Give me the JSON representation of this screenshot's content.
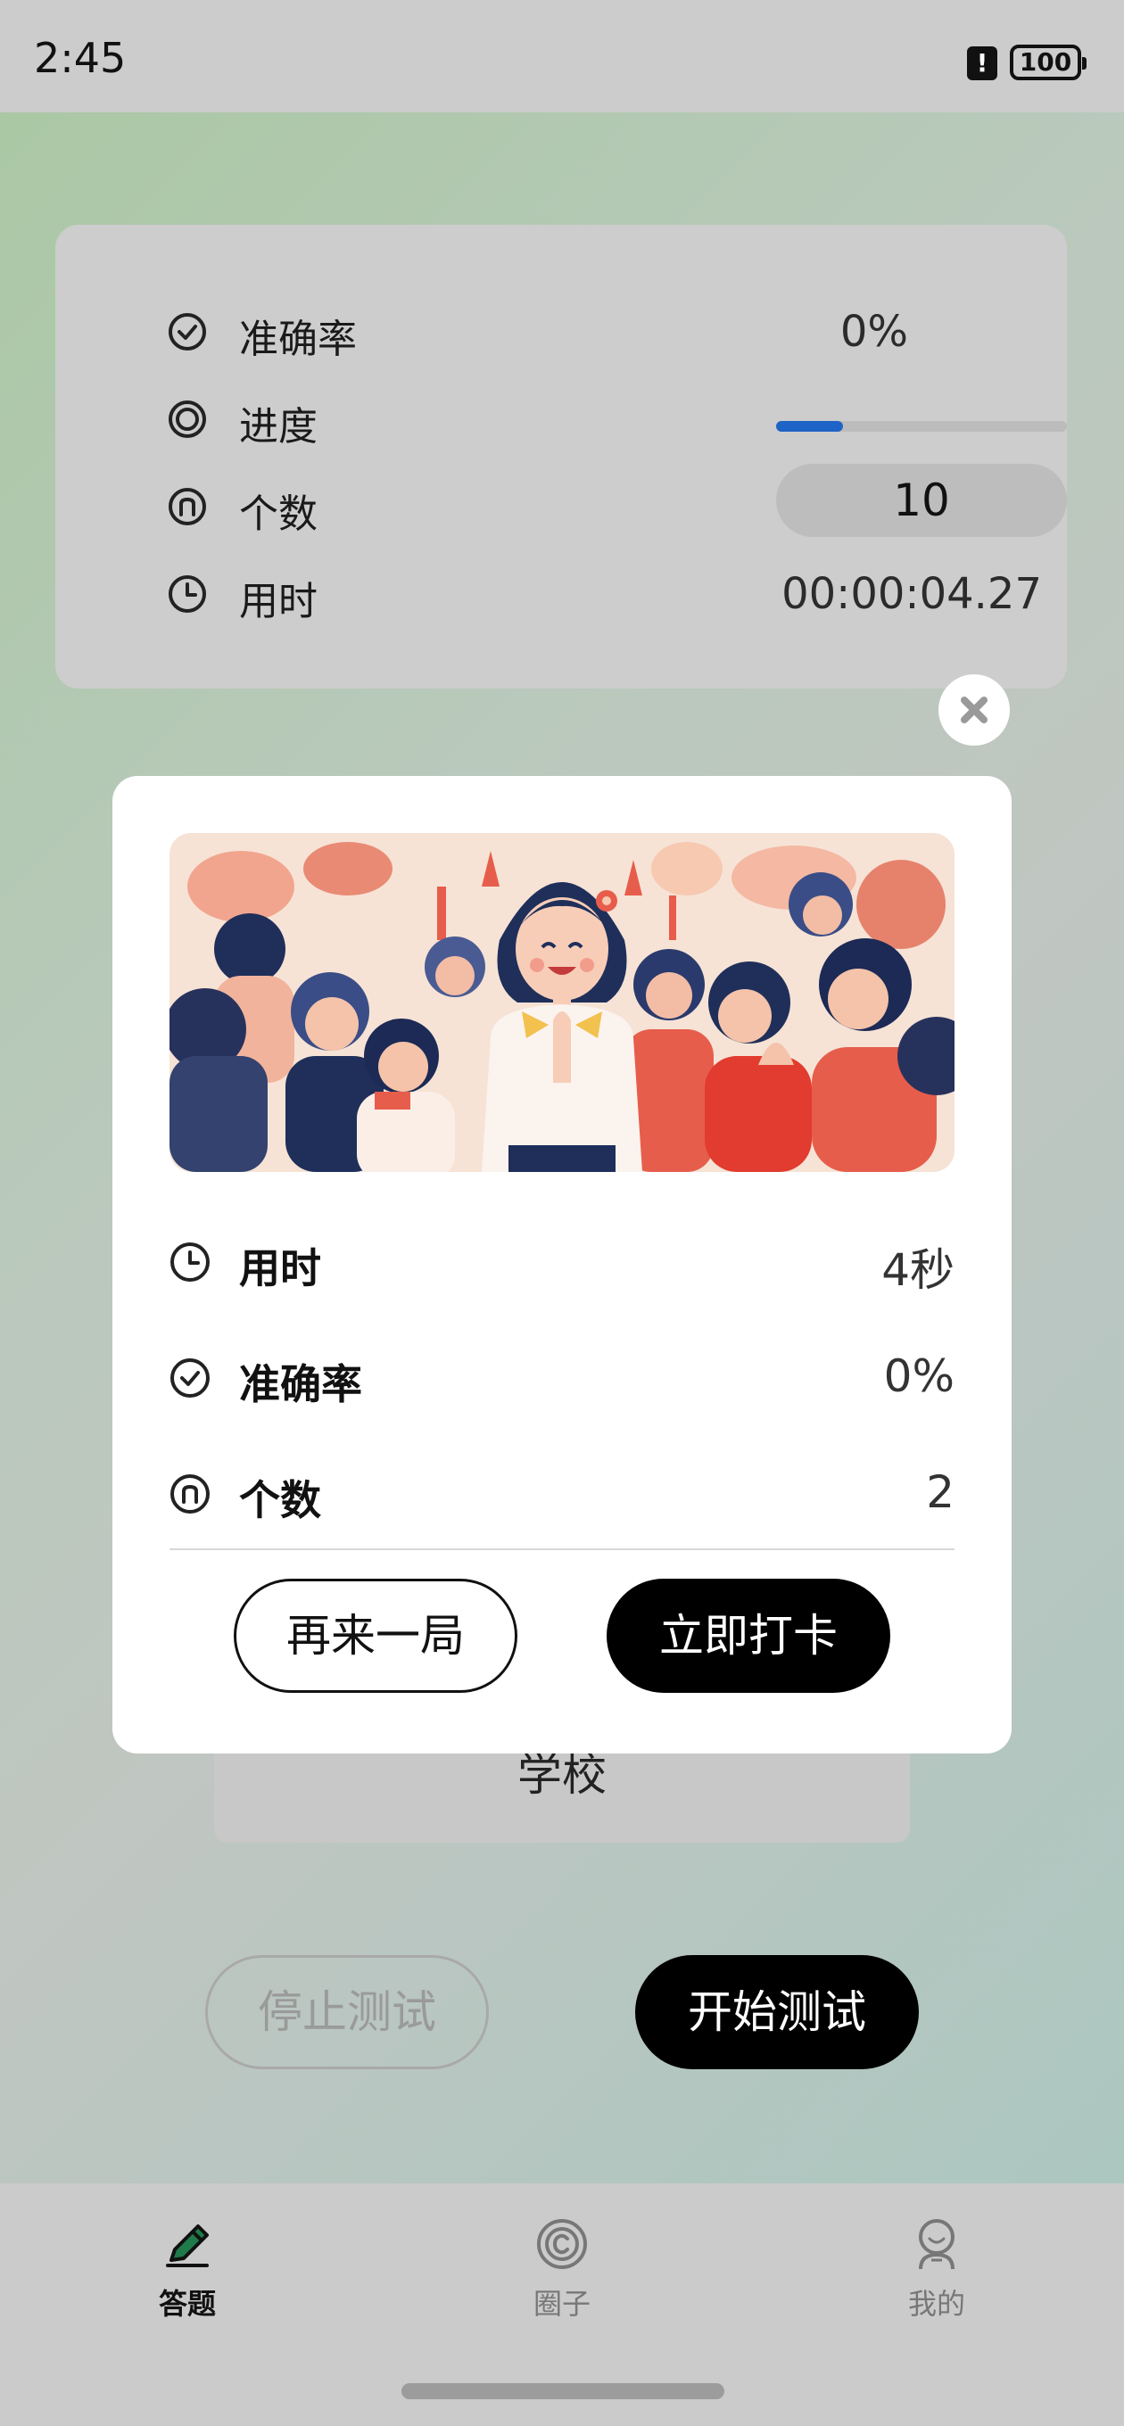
{
  "status_bar": {
    "time": "2:45",
    "battery": "100",
    "alert_icon": "alert-icon"
  },
  "stats_card": {
    "accuracy": {
      "label": "准确率",
      "value": "0%",
      "icon": "check-circle-icon"
    },
    "progress": {
      "label": "进度",
      "fraction": 0.23,
      "icon": "target-icon"
    },
    "count": {
      "label": "个数",
      "value": "10",
      "icon": "n-circle-icon"
    },
    "time_used": {
      "label": "用时",
      "value": "00:00:04.27",
      "icon": "clock-icon"
    },
    "progress_color": "#1e63c6"
  },
  "background_page": {
    "school_label": "学校",
    "stop_button": "停止测试",
    "start_button": "开始测试"
  },
  "dialog": {
    "close_icon": "close-icon",
    "illustration": "crowd-celebration-illustration",
    "rows": [
      {
        "label": "用时",
        "value": "4秒",
        "icon": "clock-icon"
      },
      {
        "label": "准确率",
        "value": "0%",
        "icon": "check-circle-icon"
      },
      {
        "label": "个数",
        "value": "2",
        "icon": "n-circle-icon"
      }
    ],
    "again_button": "再来一局",
    "checkin_button": "立即打卡"
  },
  "bottom_nav": {
    "items": [
      {
        "label": "答题",
        "icon": "pencil-icon",
        "active": true
      },
      {
        "label": "圈子",
        "icon": "circle-c-icon",
        "active": false
      },
      {
        "label": "我的",
        "icon": "profile-icon",
        "active": false
      }
    ]
  }
}
